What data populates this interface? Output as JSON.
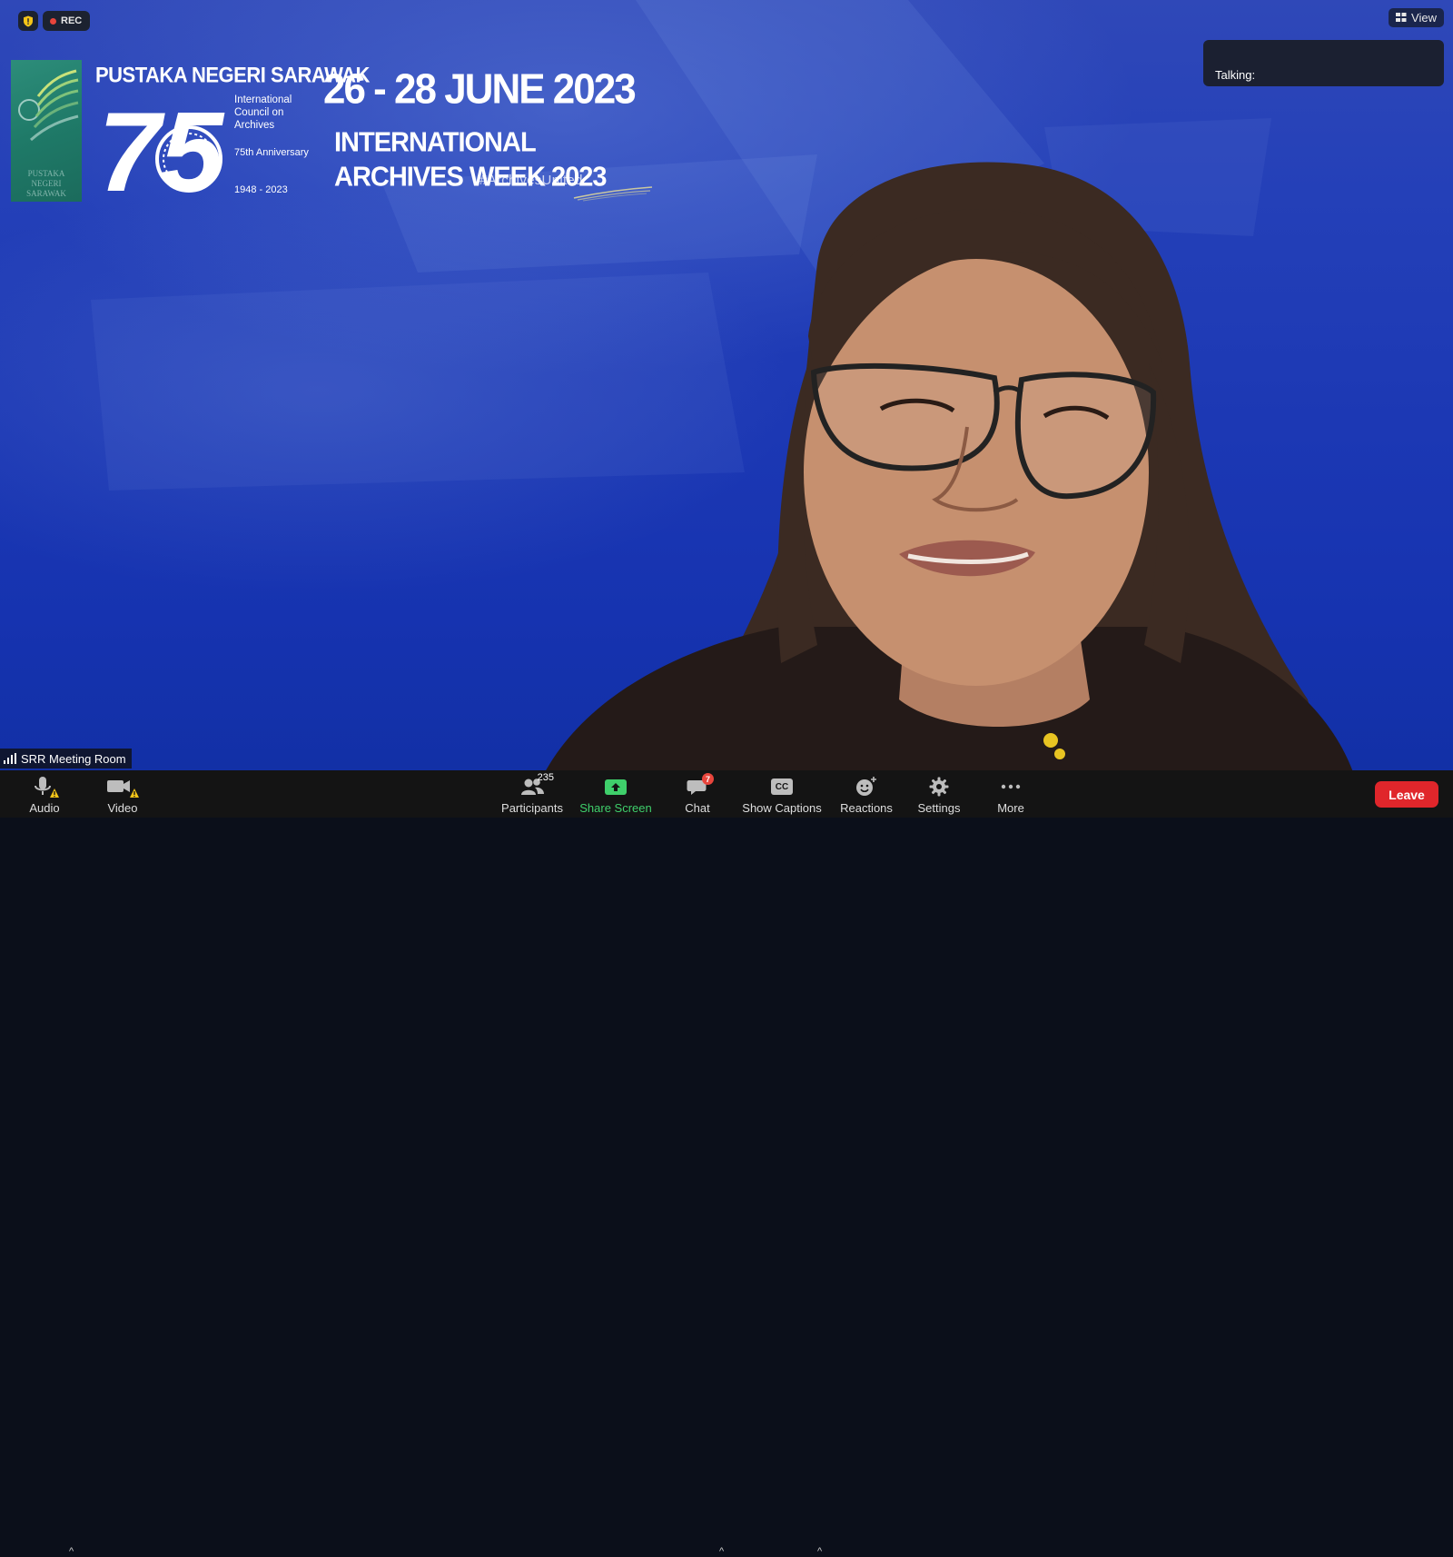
{
  "status": {
    "recording_label": "REC",
    "view_label": "View",
    "talking_label": "Talking:"
  },
  "banner": {
    "org_name": "PUSTAKA NEGERI SARAWAK",
    "anniversary_number": "75",
    "ica_line": "International Council on Archives",
    "anniversary_line": "75th Anniversary",
    "years": "1948 - 2023",
    "dates": "26 - 28 JUNE 2023",
    "event_title": "INTERNATIONAL ARCHIVES WEEK 2023",
    "hashtag": "#ArchivesUnited",
    "logo_text": "PUSTAKA NEGERI SARAWAK"
  },
  "participant": {
    "name": "SRR Meeting Room"
  },
  "toolbar": {
    "audio_label": "Audio",
    "video_label": "Video",
    "participants_label": "Participants",
    "participants_count": "235",
    "share_label": "Share Screen",
    "chat_label": "Chat",
    "chat_unread": "7",
    "captions_label": "Show Captions",
    "captions_icon_text": "CC",
    "reactions_label": "Reactions",
    "settings_label": "Settings",
    "more_label": "More",
    "leave_label": "Leave"
  },
  "colors": {
    "stage_blue": "#1c38b4",
    "toolbar_bg": "#141414",
    "leave_red": "#e0262b",
    "share_green": "#3fcf6b",
    "rec_red": "#e8453c",
    "warning_yellow": "#f5c518"
  },
  "icons": {
    "shield": "shield-icon",
    "record": "record-dot-icon",
    "view": "grid-view-icon",
    "signal": "signal-bars-icon",
    "audio": "microphone-icon",
    "video": "camera-icon",
    "warning": "warning-icon",
    "participants": "people-icon",
    "share": "share-screen-icon",
    "chat": "chat-bubble-icon",
    "captions": "closed-captions-icon",
    "reactions": "smiley-icon",
    "settings": "gear-icon",
    "more": "ellipsis-icon"
  }
}
